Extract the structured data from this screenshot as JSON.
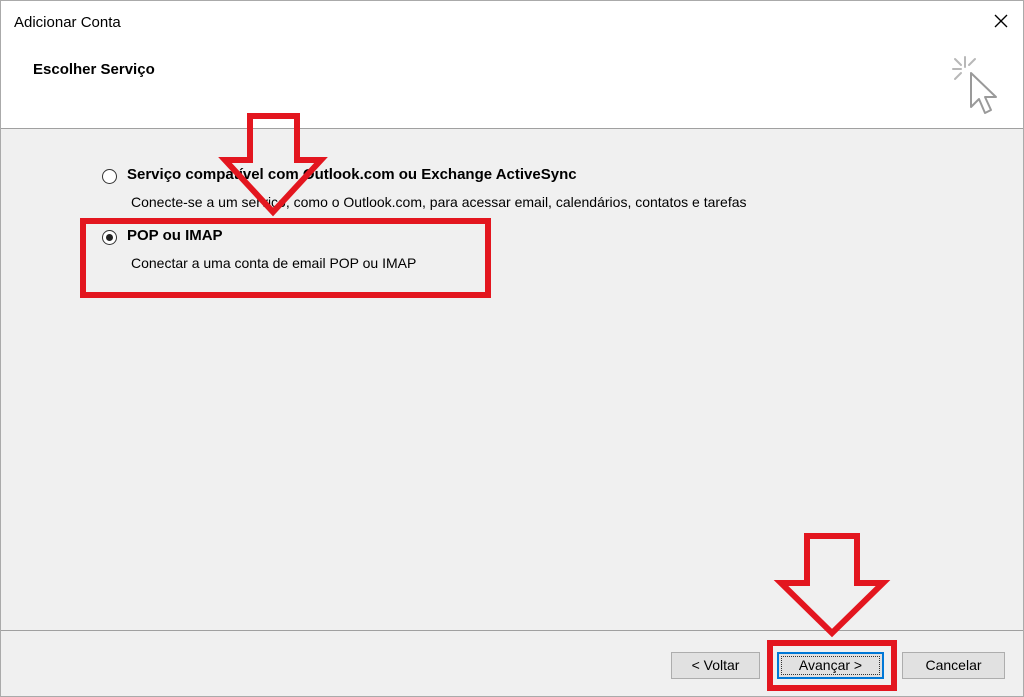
{
  "window": {
    "title": "Adicionar Conta"
  },
  "header": {
    "section_title": "Escolher Serviço",
    "icon": "cursor-click-icon"
  },
  "options": [
    {
      "label": "Serviço compatível com Outlook.com ou Exchange ActiveSync",
      "description": "Conecte-se a um serviço, como o Outlook.com, para acessar email, calendários, contatos e tarefas",
      "selected": false
    },
    {
      "label": "POP ou IMAP",
      "description": "Conectar a uma conta de email POP ou IMAP",
      "selected": true
    }
  ],
  "footer": {
    "back_label": "< Voltar",
    "next_label": "Avançar >",
    "cancel_label": "Cancelar"
  },
  "annotation_color": "#e3161f",
  "focus_color": "#0078d7"
}
